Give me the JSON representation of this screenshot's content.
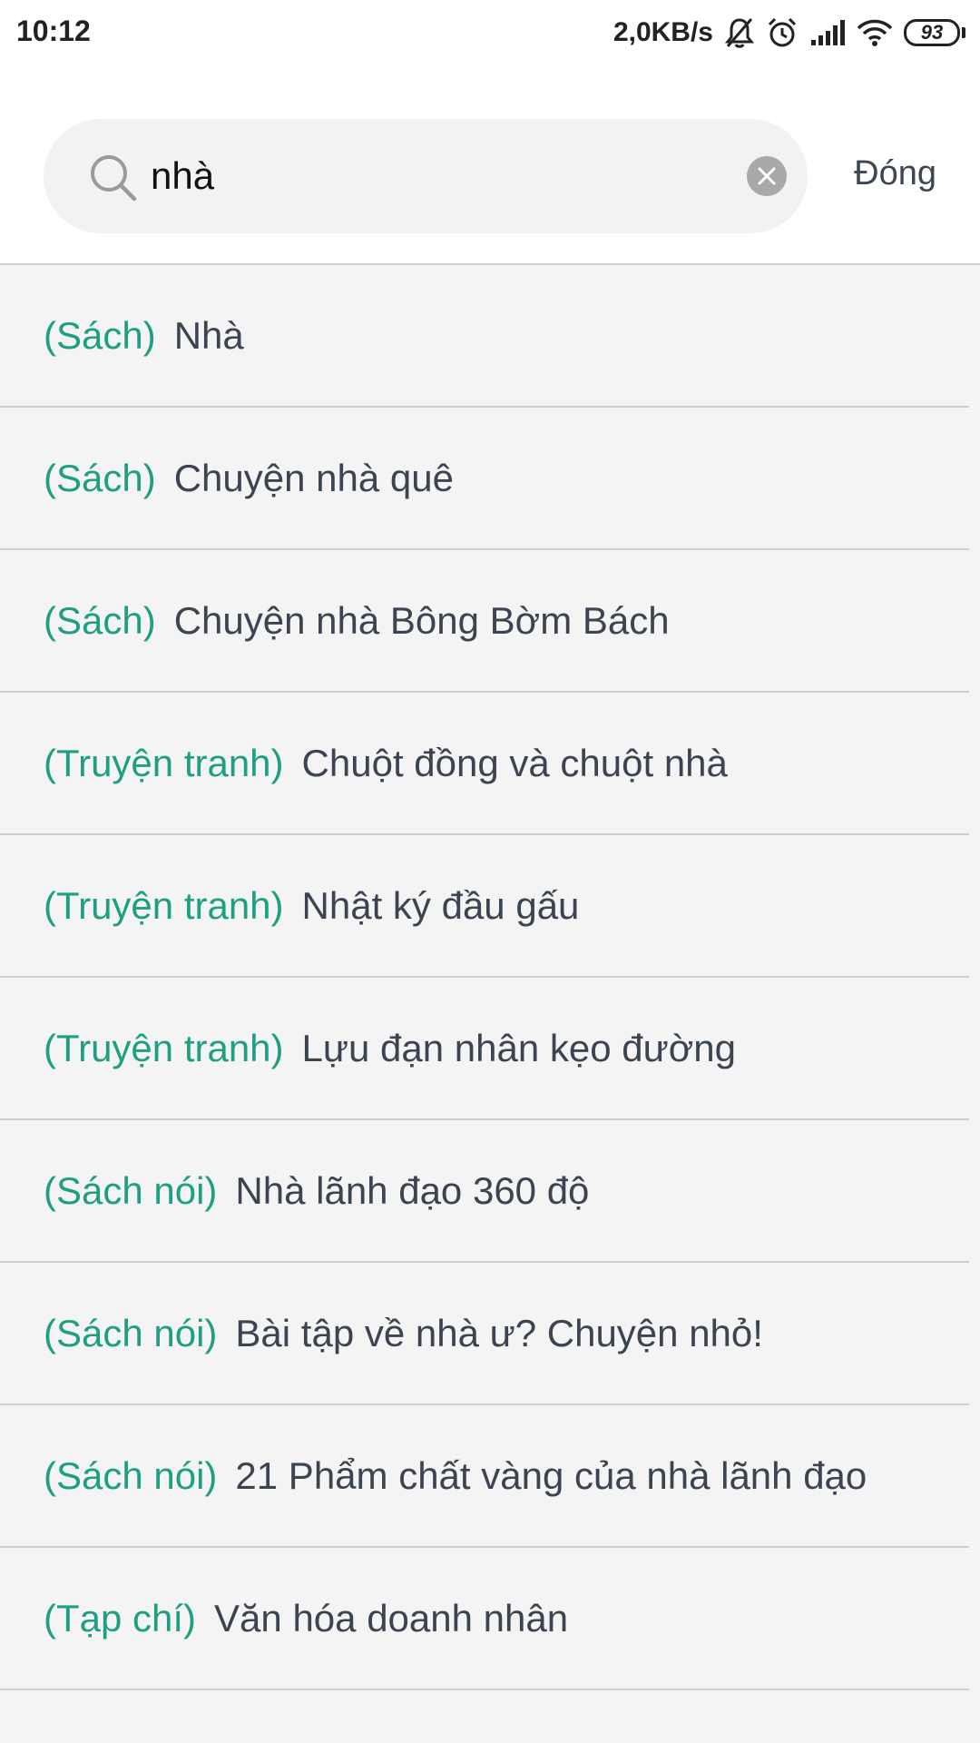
{
  "status_bar": {
    "time": "10:12",
    "net_speed": "2,0KB/s",
    "battery": "93",
    "icons": [
      "mute-bell-icon",
      "alarm-icon",
      "signal-icon",
      "wifi-icon",
      "battery-icon"
    ]
  },
  "search": {
    "value": "nhà",
    "icon": "search-icon",
    "clear_icon": "clear-icon",
    "close_label": "Đóng"
  },
  "results": [
    {
      "tag": "(Sách)",
      "title": "Nhà"
    },
    {
      "tag": "(Sách)",
      "title": "Chuyện nhà quê"
    },
    {
      "tag": "(Sách)",
      "title": "Chuyện nhà Bông Bờm Bách"
    },
    {
      "tag": "(Truyện tranh)",
      "title": "Chuột đồng và chuột nhà"
    },
    {
      "tag": "(Truyện tranh)",
      "title": "Nhật ký đầu gấu"
    },
    {
      "tag": "(Truyện tranh)",
      "title": "Lựu đạn nhân kẹo đường"
    },
    {
      "tag": "(Sách nói)",
      "title": "Nhà lãnh đạo 360 độ"
    },
    {
      "tag": "(Sách nói)",
      "title": "Bài tập về nhà ư? Chuyện nhỏ!"
    },
    {
      "tag": "(Sách nói)",
      "title": "21 Phẩm chất vàng của nhà lãnh đạo"
    },
    {
      "tag": "(Tạp chí)",
      "title": "Văn hóa doanh nhân"
    }
  ],
  "colors": {
    "accent": "#1f9f82",
    "text": "#3b4450",
    "list_background": "#f4f4f4",
    "divider": "#cfcfcf"
  }
}
